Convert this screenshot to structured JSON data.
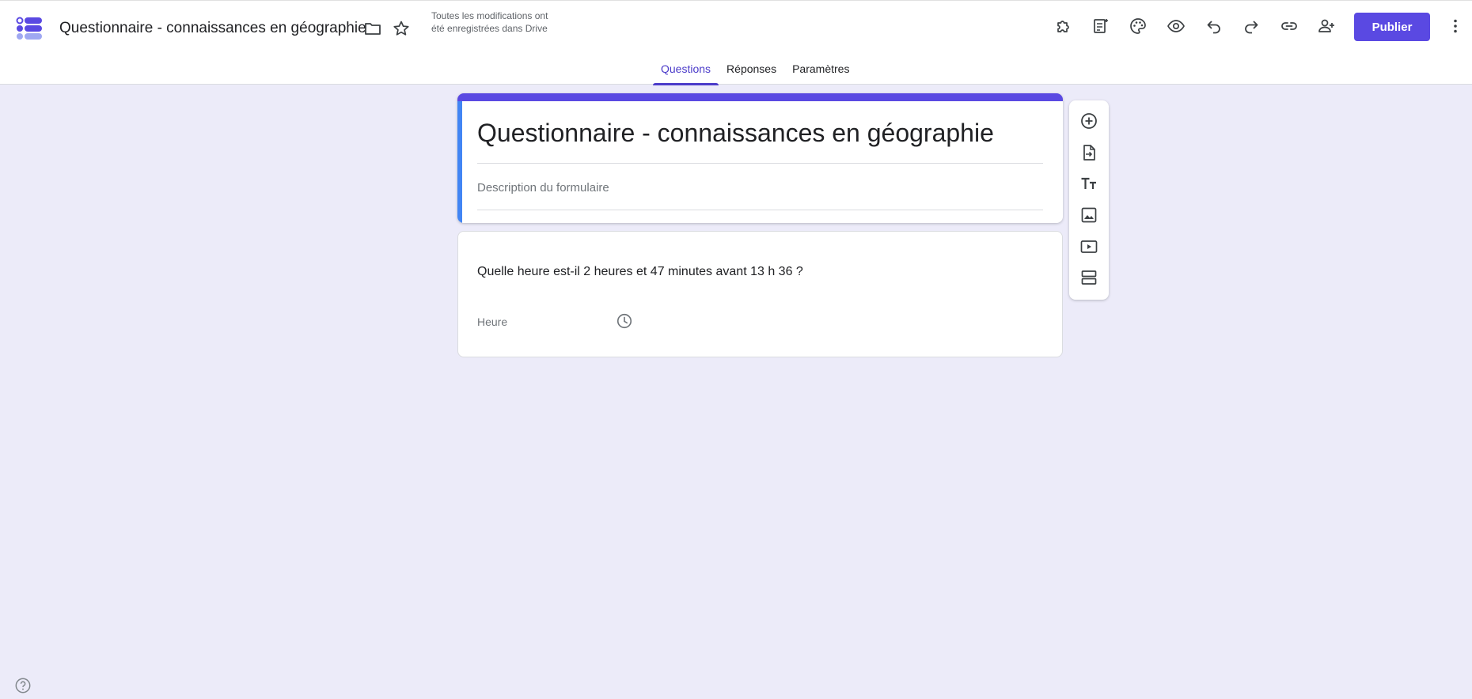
{
  "header": {
    "doc_title": "Questionnaire - connaissances en géographie",
    "save_status": "Toutes les modifications ont été enregistrées dans Drive",
    "publish_label": "Publier",
    "icons": [
      "forms-logo-icon",
      "folder-icon",
      "star-icon",
      "add-on-icon",
      "template-icon",
      "palette-icon",
      "preview-eye-icon",
      "undo-icon",
      "redo-icon",
      "link-icon",
      "add-collaborator-icon",
      "more-vert-icon"
    ]
  },
  "tabs": [
    {
      "label": "Questions",
      "active": true
    },
    {
      "label": "Réponses",
      "active": false
    },
    {
      "label": "Paramètres",
      "active": false
    }
  ],
  "form": {
    "title": "Questionnaire - connaissances en géographie",
    "description_placeholder": "Description du formulaire"
  },
  "question": {
    "text": "Quelle heure est-il 2 heures et 47 minutes avant 13 h 36 ?",
    "answer_label": "Heure"
  },
  "side_toolbar": {
    "icons": [
      "add-question-icon",
      "import-questions-icon",
      "add-title-icon",
      "add-image-icon",
      "add-video-icon",
      "add-section-icon"
    ]
  },
  "colors": {
    "accent": "#5a49e2",
    "tab_active": "#4b3bc9",
    "background": "#ecebf9",
    "card_left_border": "#4285f4"
  }
}
